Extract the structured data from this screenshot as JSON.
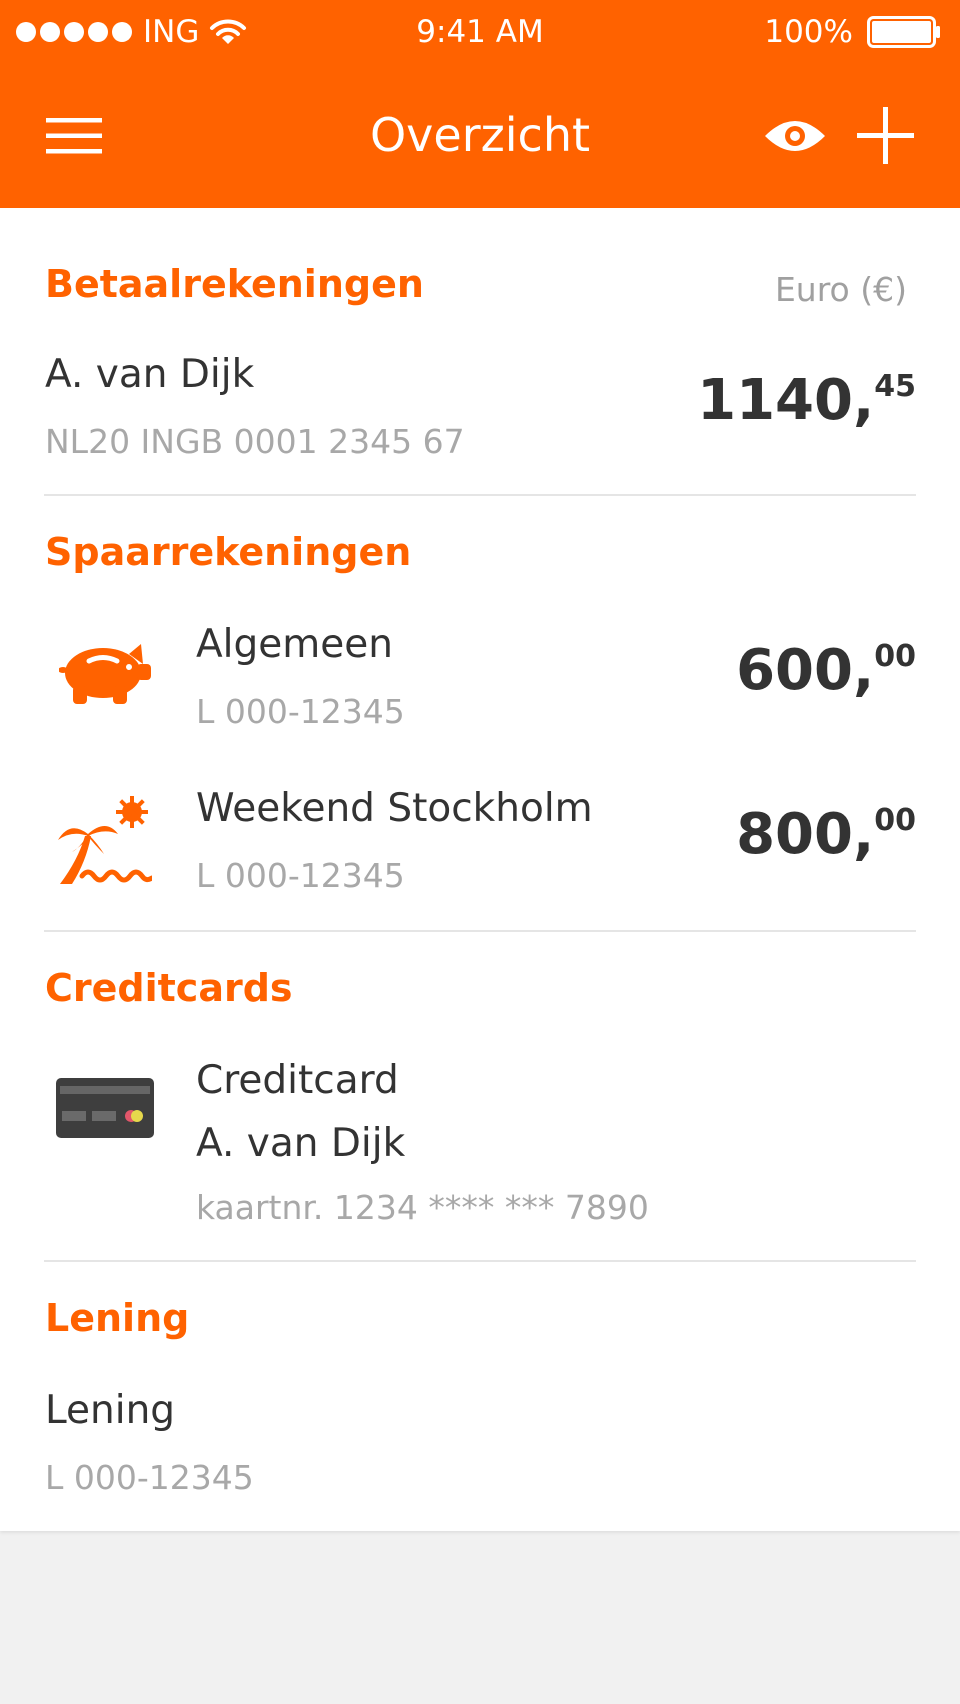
{
  "status_bar": {
    "carrier": "ING",
    "time": "9:41 AM",
    "battery": "100%"
  },
  "nav": {
    "title": "Overzicht",
    "icons": [
      "menu-icon",
      "eye-icon",
      "plus-icon"
    ]
  },
  "colors": {
    "brand_orange": "#ff6200",
    "text": "#333333",
    "muted": "#a8a8a8"
  },
  "sections": {
    "betaal": {
      "title": "Betaalrekeningen",
      "currency": "Euro (€)",
      "accounts": [
        {
          "name": "A. van Dijk",
          "number": "NL20 INGB 0001 2345 67",
          "amount_int": "1140,",
          "amount_dec": "45"
        }
      ]
    },
    "spaar": {
      "title": "Spaarrekeningen",
      "accounts": [
        {
          "icon": "piggy-bank-icon",
          "name": "Algemeen",
          "number": "L 000-12345",
          "amount_int": "600,",
          "amount_dec": "00"
        },
        {
          "icon": "palm-tree-sun-icon",
          "name": "Weekend Stockholm",
          "number": "L 000-12345",
          "amount_int": "800,",
          "amount_dec": "00"
        }
      ]
    },
    "credit": {
      "title": "Creditcards",
      "accounts": [
        {
          "icon": "credit-card-icon",
          "name_line1": "Creditcard",
          "name_line2": "A. van Dijk",
          "number": "kaartnr. 1234 **** *** 7890"
        }
      ]
    },
    "lening": {
      "title": "Lening",
      "accounts": [
        {
          "name": "Lening",
          "number": "L 000-12345"
        }
      ]
    }
  }
}
